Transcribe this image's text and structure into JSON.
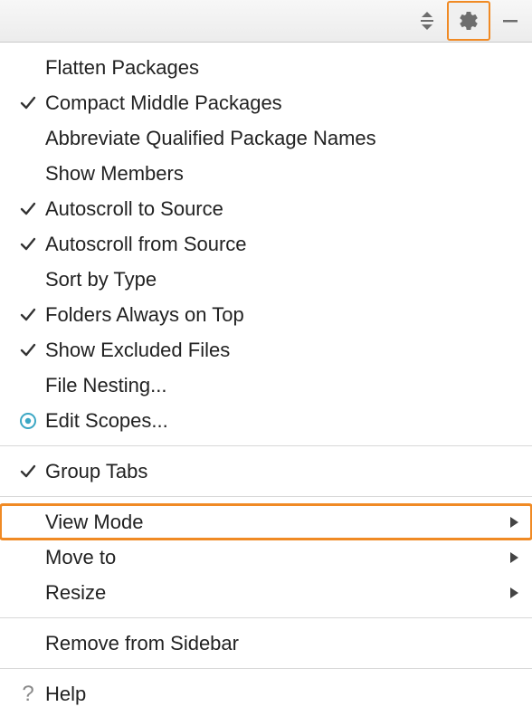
{
  "toolbar": {
    "gear_highlighted": true
  },
  "menu": {
    "group1": [
      {
        "label": "Flatten Packages",
        "checked": false,
        "icon": "none"
      },
      {
        "label": "Compact Middle Packages",
        "checked": true,
        "icon": "check"
      },
      {
        "label": "Abbreviate Qualified Package Names",
        "checked": false,
        "icon": "none"
      },
      {
        "label": "Show Members",
        "checked": false,
        "icon": "none"
      },
      {
        "label": "Autoscroll to Source",
        "checked": true,
        "icon": "check"
      },
      {
        "label": "Autoscroll from Source",
        "checked": true,
        "icon": "check"
      },
      {
        "label": "Sort by Type",
        "checked": false,
        "icon": "none"
      },
      {
        "label": "Folders Always on Top",
        "checked": true,
        "icon": "check"
      },
      {
        "label": "Show Excluded Files",
        "checked": true,
        "icon": "check"
      },
      {
        "label": "File Nesting...",
        "checked": false,
        "icon": "none"
      },
      {
        "label": "Edit Scopes...",
        "checked": false,
        "icon": "radio"
      }
    ],
    "group2": [
      {
        "label": "Group Tabs",
        "checked": true,
        "icon": "check"
      }
    ],
    "group3": [
      {
        "label": "View Mode",
        "submenu": true,
        "highlighted": true
      },
      {
        "label": "Move to",
        "submenu": true
      },
      {
        "label": "Resize",
        "submenu": true
      }
    ],
    "group4": [
      {
        "label": "Remove from Sidebar"
      }
    ],
    "group5": [
      {
        "label": "Help",
        "icon": "help"
      }
    ]
  }
}
